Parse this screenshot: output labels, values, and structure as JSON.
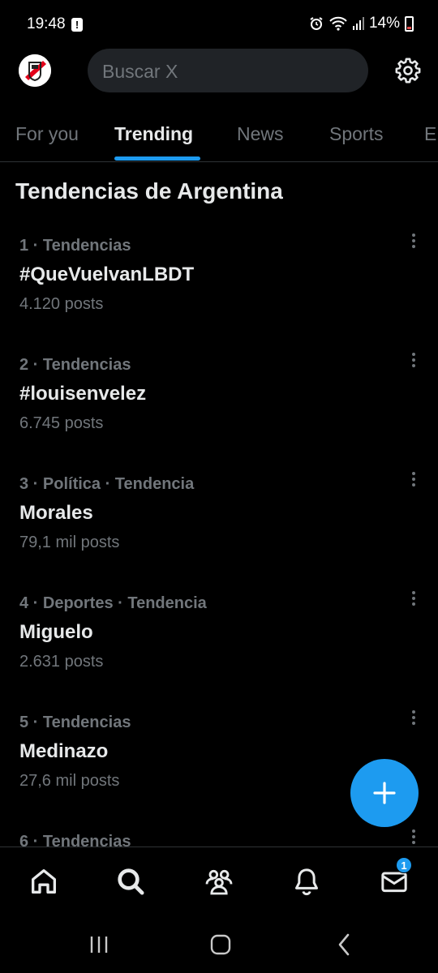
{
  "status": {
    "time": "19:48",
    "alert_glyph": "!",
    "battery": "14%",
    "icons": [
      "alarm-icon",
      "wifi-icon",
      "signal-icon",
      "battery-icon"
    ]
  },
  "header": {
    "avatar_icon": "river-plate-crest-icon",
    "search_placeholder": "Buscar X",
    "settings_icon": "gear-icon"
  },
  "tabs": [
    {
      "label": "For you",
      "active": false
    },
    {
      "label": "Trending",
      "active": true
    },
    {
      "label": "News",
      "active": false
    },
    {
      "label": "Sports",
      "active": false
    },
    {
      "label": "E",
      "active": false
    }
  ],
  "section_title": "Tendencias de Argentina",
  "trends": [
    {
      "meta": "1 · Tendencias",
      "name": "#QueVuelvanLBDT",
      "count": "4.120 posts"
    },
    {
      "meta": "2 · Tendencias",
      "name": "#louisenvelez",
      "count": "6.745 posts"
    },
    {
      "meta": "3 · Política · Tendencia",
      "name": "Morales",
      "count": "79,1 mil posts"
    },
    {
      "meta": "4 · Deportes · Tendencia",
      "name": "Miguelo",
      "count": "2.631 posts"
    },
    {
      "meta": "5 · Tendencias",
      "name": "Medinazo",
      "count": "27,6 mil posts"
    },
    {
      "meta": "6 · Tendencias",
      "name": "",
      "count": ""
    }
  ],
  "fab_icon": "plus-icon",
  "bottom_nav": {
    "items": [
      "home-icon",
      "search-icon",
      "communities-icon",
      "notifications-icon",
      "messages-icon"
    ],
    "messages_badge": "1"
  },
  "system_nav": [
    "recents-icon",
    "home-circle-icon",
    "back-icon"
  ],
  "colors": {
    "background": "#000000",
    "accent": "#1d9bf0",
    "text_primary": "#e7e9ea",
    "text_secondary": "#71767b",
    "search_bg": "#202327",
    "divider": "#2f3336"
  }
}
